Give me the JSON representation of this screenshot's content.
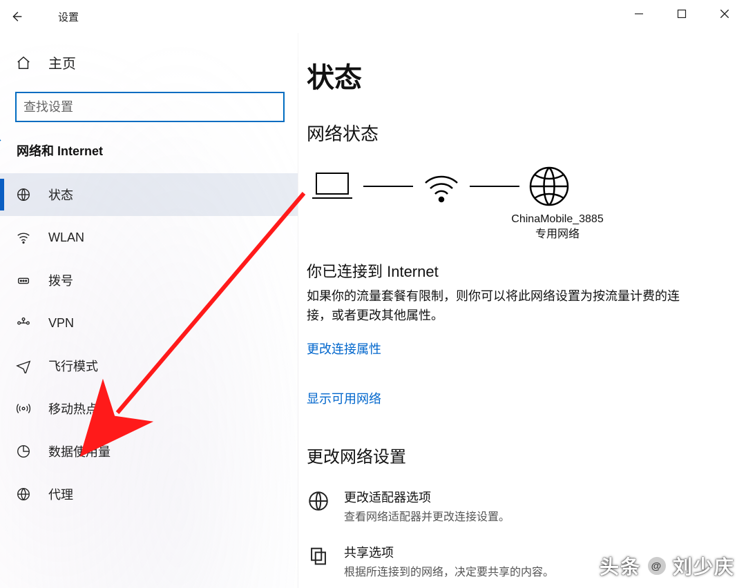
{
  "window": {
    "title": "设置"
  },
  "sidebar": {
    "home_label": "主页",
    "search_placeholder": "查找设置",
    "category": "网络和 Internet",
    "items": [
      {
        "label": "状态"
      },
      {
        "label": "WLAN"
      },
      {
        "label": "拨号"
      },
      {
        "label": "VPN"
      },
      {
        "label": "飞行模式"
      },
      {
        "label": "移动热点"
      },
      {
        "label": "数据使用量"
      },
      {
        "label": "代理"
      }
    ]
  },
  "content": {
    "page_title": "状态",
    "status_heading": "网络状态",
    "connection_name": "ChinaMobile_3885",
    "connection_type": "专用网络",
    "connected_heading": "你已连接到 Internet",
    "connected_body": "如果你的流量套餐有限制，则你可以将此网络设置为按流量计费的连接，或者更改其他属性。",
    "link_change_props": "更改连接属性",
    "link_show_networks": "显示可用网络",
    "change_settings_heading": "更改网络设置",
    "adapter_title": "更改适配器选项",
    "adapter_desc": "查看网络适配器并更改连接设置。",
    "sharing_title": "共享选项",
    "sharing_desc": "根据所连接到的网络，决定要共享的内容。"
  },
  "watermark": {
    "prefix": "头条",
    "author": "刘少庆"
  }
}
